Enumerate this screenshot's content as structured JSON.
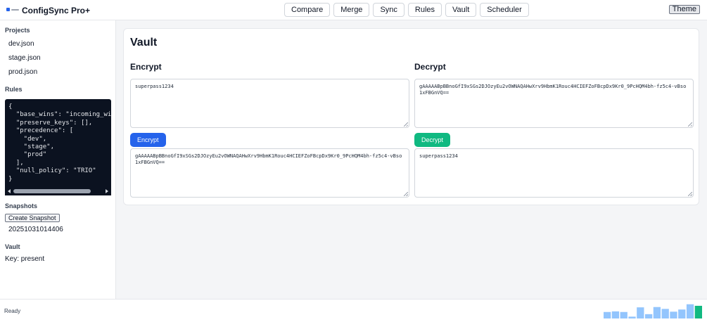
{
  "app": {
    "title": "ConfigSync Pro+",
    "logo_icon": "app-logo-icon"
  },
  "nav": [
    {
      "label": "Compare"
    },
    {
      "label": "Merge"
    },
    {
      "label": "Sync"
    },
    {
      "label": "Rules"
    },
    {
      "label": "Vault"
    },
    {
      "label": "Scheduler"
    }
  ],
  "theme_label": "Theme",
  "sidebar": {
    "projects_heading": "Projects",
    "projects": [
      "dev.json",
      "stage.json",
      "prod.json"
    ],
    "rules_heading": "Rules",
    "rules_json": "{\n  \"base_wins\": \"incoming_wins\",\n  \"preserve_keys\": [],\n  \"precedence\": [\n    \"dev\",\n    \"stage\",\n    \"prod\"\n  ],\n  \"null_policy\": \"TRIO\"\n}",
    "snapshots_heading": "Snapshots",
    "create_snapshot_label": "Create Snapshot",
    "snapshots": [
      "20251031014406"
    ],
    "vault_heading": "Vault",
    "vault_key_status": "Key: present"
  },
  "vault": {
    "title": "Vault",
    "encrypt_heading": "Encrypt",
    "decrypt_heading": "Decrypt",
    "encrypt_input": "superpass1234",
    "encrypt_button": "Encrypt",
    "encrypt_output": "gAAAAABpBBnoGfI9xSGs2DJOzyEu2vOWNAQAHwXrv9HbmK1Rouc4HCIEFZoFBcpDx9Kr0_9PcHQM4bh-fz5c4-vBso1xFBGnVQ==",
    "decrypt_input": "gAAAAABpBBnoGfI9xSGs2DJOzyEu2vOWNAQAHwXrv9HbmK1Rouc4HCIEFZoFBcpDx9Kr0_9PcHQM4bh-fz5c4-vBso1xFBGnVQ==",
    "decrypt_button": "Decrypt",
    "decrypt_output": "superpass1234",
    "colors": {
      "encrypt": "#2563eb",
      "decrypt": "#10b981"
    }
  },
  "status": {
    "text": "Ready",
    "activity_levels": [
      0.42,
      0.46,
      0.42,
      0.12,
      0.72,
      0.28,
      0.74,
      0.62,
      0.44,
      0.58,
      0.92,
      0.82
    ],
    "colors": {
      "bar": "#93c5fd",
      "current": "#10b981"
    }
  }
}
